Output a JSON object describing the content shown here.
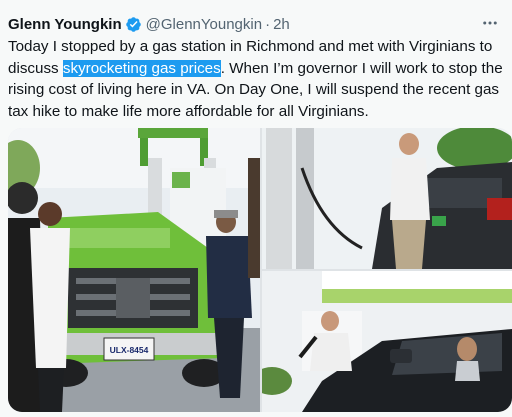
{
  "tweet": {
    "author_name": "Glenn Youngkin",
    "handle": "@GlennYoungkin",
    "separator": "·",
    "time": "2h",
    "text_before": "Today I stopped by a gas station in Richmond and met with Virginians to discuss ",
    "text_highlight": "skyrocketing gas prices",
    "text_after": ". When I’m governor I will work to stop the rising cost of living here in VA. On Day One, I will suspend the recent gas tax hike to make life more affordable for all Virginians."
  },
  "media": {
    "photo1": {
      "plate_text": "ULX-8454"
    }
  },
  "icons": {
    "verified": "verified-badge-icon",
    "more": "more-options-icon"
  },
  "colors": {
    "accent": "#1d9bf0",
    "text": "#0f1419",
    "secondary_text": "#536471",
    "background": "#f7f9f9",
    "truck_green": "#6fbf3a"
  }
}
